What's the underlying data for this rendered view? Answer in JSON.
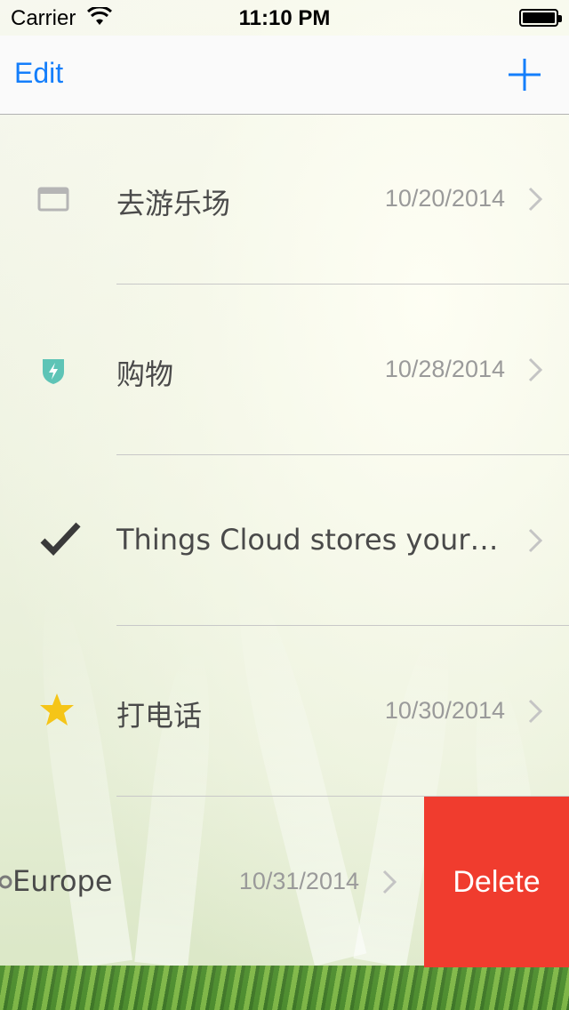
{
  "status_bar": {
    "carrier": "Carrier",
    "time": "11:10 PM"
  },
  "nav": {
    "edit_label": "Edit",
    "add_icon": "plus-icon"
  },
  "rows": [
    {
      "icon": "calendar-window-icon",
      "title": "去游乐场",
      "date": "10/20/2014"
    },
    {
      "icon": "shield-bolt-icon",
      "title": "购物",
      "date": "10/28/2014"
    },
    {
      "icon": "checkmark-icon",
      "title": "Things Cloud stores your…",
      "date": ""
    },
    {
      "icon": "star-icon",
      "title": "打电话",
      "date": "10/30/2014"
    },
    {
      "icon": "dot-icon",
      "title": "Europe",
      "date": "10/31/2014"
    }
  ],
  "swipe_action": {
    "delete_label": "Delete",
    "color": "#f03c2e"
  },
  "colors": {
    "accent": "#147efb",
    "star": "#f5c518",
    "shield": "#5ec4b6"
  }
}
